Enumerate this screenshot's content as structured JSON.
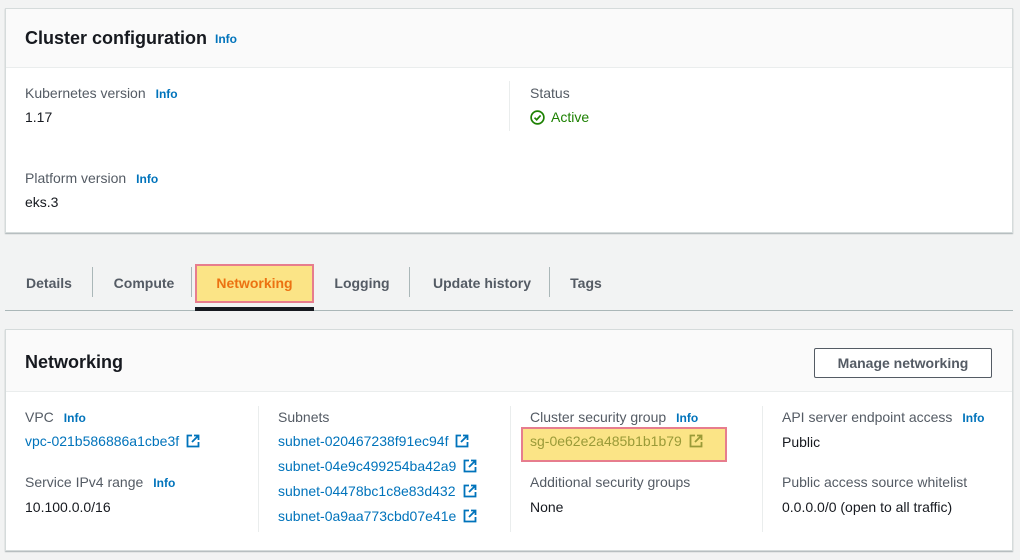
{
  "cluster_config": {
    "title": "Cluster configuration",
    "info": "Info",
    "kubernetes_version_label": "Kubernetes version",
    "kubernetes_version_info": "Info",
    "kubernetes_version_value": "1.17",
    "status_label": "Status",
    "status_value": "Active",
    "platform_version_label": "Platform version",
    "platform_version_info": "Info",
    "platform_version_value": "eks.3"
  },
  "tabs": [
    {
      "label": "Details"
    },
    {
      "label": "Compute"
    },
    {
      "label": "Networking"
    },
    {
      "label": "Logging"
    },
    {
      "label": "Update history"
    },
    {
      "label": "Tags"
    }
  ],
  "networking": {
    "title": "Networking",
    "manage_button": "Manage networking",
    "vpc_label": "VPC",
    "vpc_info": "Info",
    "vpc_value": "vpc-021b586886a1cbe3f",
    "service_range_label": "Service IPv4 range",
    "service_range_info": "Info",
    "service_range_value": "10.100.0.0/16",
    "subnets_label": "Subnets",
    "subnets": [
      "subnet-020467238f91ec94f",
      "subnet-04e9c499254ba42a9",
      "subnet-04478bc1c8e83d432",
      "subnet-0a9aa773cbd07e41e"
    ],
    "cluster_sg_label": "Cluster security group",
    "cluster_sg_info": "Info",
    "cluster_sg_value": "sg-0e62e2a485b1b1b79",
    "additional_sg_label": "Additional security groups",
    "additional_sg_value": "None",
    "api_access_label": "API server endpoint access",
    "api_access_info": "Info",
    "api_access_value": "Public",
    "whitelist_label": "Public access source whitelist",
    "whitelist_value": "0.0.0.0/0 (open to all traffic)"
  },
  "colors": {
    "link": "#0073bb",
    "active_status": "#1d8102",
    "active_tab": "#ec7211",
    "highlight": "#fbe486",
    "highlight_border": "#e77d8d"
  }
}
